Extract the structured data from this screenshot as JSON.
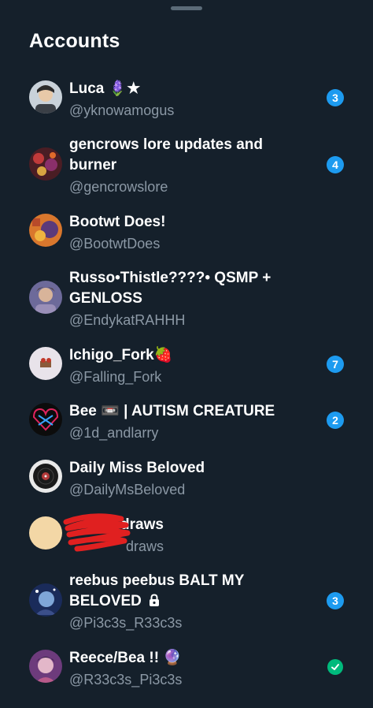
{
  "sheet": {
    "title": "Accounts"
  },
  "accounts": [
    {
      "name": "Luca 🪻★",
      "handle": "@yknowamogus",
      "badge": "3",
      "avatar_color": "#c9d2da"
    },
    {
      "name": "gencrows lore updates and burner",
      "handle": "@gencrowslore",
      "badge": "4",
      "avatar_color": "#6a2a2a"
    },
    {
      "name": "Bootwt Does!",
      "handle": "@BootwtDoes",
      "badge": "",
      "avatar_color": "#d9772d"
    },
    {
      "name": "Russo•Thistle????• QSMP + GENLOSS",
      "handle": "@EndykatRAHHH",
      "badge": "",
      "avatar_color": "#6d6a9a"
    },
    {
      "name": "Ichigo_Fork🍓",
      "handle": "@Falling_Fork",
      "badge": "7",
      "avatar_color": "#e8e3ea"
    },
    {
      "name": "Bee 📼 | AUTISM CREATURE",
      "handle": "@1d_andlarry",
      "badge": "2",
      "avatar_color": "#0c0c0c"
    },
    {
      "name": "Daily Miss Beloved",
      "handle": "@DailyMsBeloved",
      "badge": "",
      "avatar_color": "#e9e9e9"
    },
    {
      "name": "draws",
      "handle": "draws",
      "badge": "",
      "avatar_color": "#f3d7a6"
    },
    {
      "name": "reebus peebus BALT MY BELOVED",
      "handle": "@Pi3c3s_R33c3s",
      "badge": "3",
      "locked": true,
      "avatar_color": "#1a2b5a"
    },
    {
      "name": "Reece/Bea !! 🔮",
      "handle": "@R33c3s_Pi3c3s",
      "badge": "",
      "active": true,
      "avatar_color": "#6d3b7c"
    }
  ],
  "colors": {
    "accent": "#1d9bf0",
    "active": "#00ba7c",
    "background": "#15202b",
    "muted": "#8b98a5"
  }
}
